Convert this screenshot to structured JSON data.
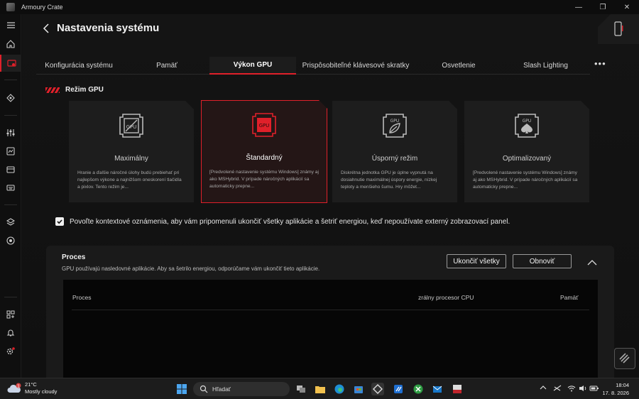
{
  "window": {
    "title": "Armoury Crate",
    "controls": [
      "—",
      "❐",
      "✕"
    ]
  },
  "header": {
    "title": "Nastavenia systému"
  },
  "tabs": [
    {
      "label": "Konfigurácia systému"
    },
    {
      "label": "Pamäť"
    },
    {
      "label": "Výkon GPU",
      "active": true
    },
    {
      "label": "Prispôsobiteľné klávesové skratky"
    },
    {
      "label": "Osvetlenie"
    },
    {
      "label": "Slash Lighting"
    }
  ],
  "more_label": "•••",
  "gpu_mode": {
    "section_label": "Režim GPU",
    "cards": [
      {
        "name": "Maximálny",
        "icon": "gpu-chip-icon",
        "description": "Hranie a ďalšie náročné úlohy budú prebiehať pri najlepšom výkone a najnižšom oneskorení tlačidla a pixlov. Tento režim je...",
        "selected": false
      },
      {
        "name": "Štandardný",
        "icon": "gpu-chip-icon",
        "description": "[Predvolené nastavenie systému Windows] známy aj ako MSHybrid. V prípade náročných aplikácií sa automaticky prepne...",
        "selected": true
      },
      {
        "name": "Úsporný režim",
        "icon": "gpu-leaf-icon",
        "description": "Diskrétna jednotka GPU je úplne vypnutá na dosiahnutie maximálnej úspory energie, nízkej teploty a menšieho šumu. Hry môžet...",
        "selected": false
      },
      {
        "name": "Optimalizovaný",
        "icon": "gpu-spade-icon",
        "description": "[Predvolené nastavenie systému Windows] známy aj ako MSHybrid. V prípade náročných aplikácií sa automaticky prepne...",
        "selected": false
      }
    ]
  },
  "notification_checkbox": {
    "checked": true,
    "label": "Povoľte kontextové oznámenia, aby vám pripomenuli ukončiť všetky aplikácie a šetriť energiou, keď nepoužívate externý zobrazovací panel."
  },
  "process_panel": {
    "title": "Proces",
    "description": "GPU používajú nasledovné aplikácie. Aby sa šetrilo energiou, odporúčame vám ukončiť tieto aplikácie.",
    "end_all_label": "Ukončiť všetky",
    "refresh_label": "Obnoviť",
    "columns": [
      "Proces",
      "zrálny procesor CPU",
      "Pamäť"
    ]
  },
  "taskbar": {
    "weather": {
      "temp": "21°C",
      "condition": "Mostly cloudy",
      "badge": "1"
    },
    "search_placeholder": "Hľadať",
    "clock": {
      "time": "18:04",
      "date": "17. 8. 2026"
    }
  },
  "colors": {
    "accent": "#e0202a",
    "background": "#111111",
    "card": "#1d1d1d"
  }
}
